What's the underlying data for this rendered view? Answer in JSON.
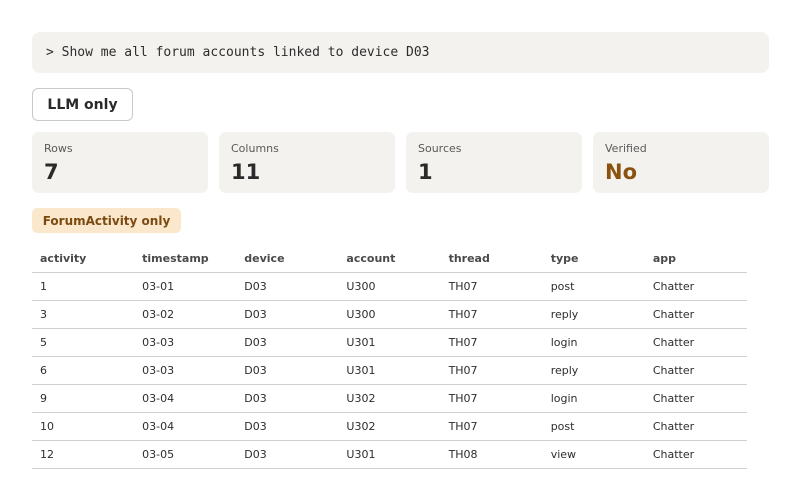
{
  "query": {
    "prompt_text": "> Show me all forum accounts linked to device D03"
  },
  "mode": {
    "label": "LLM only"
  },
  "stats": [
    {
      "label": "Rows",
      "value": "7"
    },
    {
      "label": "Columns",
      "value": "11"
    },
    {
      "label": "Sources",
      "value": "1"
    },
    {
      "label": "Verified",
      "value": "No"
    }
  ],
  "colors": {
    "verified_no": "#8a5210",
    "badge_bg": "#fbe7cc",
    "badge_text": "#7a4a10",
    "panel_bg": "#f4f2ee"
  },
  "source_badge": {
    "label": "ForumActivity only"
  },
  "table": {
    "columns": [
      "activity",
      "timestamp",
      "device",
      "account",
      "thread",
      "type",
      "app"
    ],
    "rows": [
      [
        "1",
        "03-01",
        "D03",
        "U300",
        "TH07",
        "post",
        "Chatter"
      ],
      [
        "3",
        "03-02",
        "D03",
        "U300",
        "TH07",
        "reply",
        "Chatter"
      ],
      [
        "5",
        "03-03",
        "D03",
        "U301",
        "TH07",
        "login",
        "Chatter"
      ],
      [
        "6",
        "03-03",
        "D03",
        "U301",
        "TH07",
        "reply",
        "Chatter"
      ],
      [
        "9",
        "03-04",
        "D03",
        "U302",
        "TH07",
        "login",
        "Chatter"
      ],
      [
        "10",
        "03-04",
        "D03",
        "U302",
        "TH07",
        "post",
        "Chatter"
      ],
      [
        "12",
        "03-05",
        "D03",
        "U301",
        "TH08",
        "view",
        "Chatter"
      ]
    ]
  }
}
